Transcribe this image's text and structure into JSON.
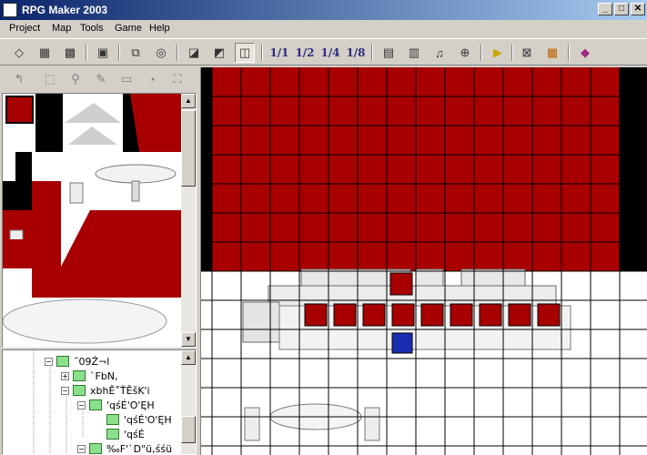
{
  "window": {
    "title": "RPG Maker 2003"
  },
  "window_controls": [
    {
      "name": "minimize-button",
      "glyph": "_"
    },
    {
      "name": "maximize-button",
      "glyph": "□"
    },
    {
      "name": "close-button",
      "glyph": "✕"
    }
  ],
  "menu": [
    "Project",
    "Map",
    "Tools",
    "Game",
    "Help"
  ],
  "toolbar": {
    "zoom_labels": [
      "1/1",
      "1/2",
      "1/4",
      "1/8"
    ]
  },
  "tree": {
    "nodes": [
      {
        "label": "˜09Ź¬l",
        "expander": "−",
        "depth": 0
      },
      {
        "label": "`FbN,",
        "expander": "+",
        "depth": 1
      },
      {
        "label": "xbhĚ˚ŤĚšK'i",
        "expander": "−",
        "depth": 1
      },
      {
        "label": "'qśÉ'O'ĘH",
        "expander": "−",
        "depth": 2
      },
      {
        "label": "'qśÉ'O'ĘH",
        "expander": "",
        "depth": 3
      },
      {
        "label": "'qśÉ",
        "expander": "",
        "depth": 3
      },
      {
        "label": "‰F'`D\"ü‚śśü",
        "expander": "−",
        "depth": 2
      }
    ]
  },
  "colors": {
    "accent": "#a80000",
    "grid": "#000000",
    "title_start": "#0a246a",
    "title_end": "#a6caf0"
  }
}
